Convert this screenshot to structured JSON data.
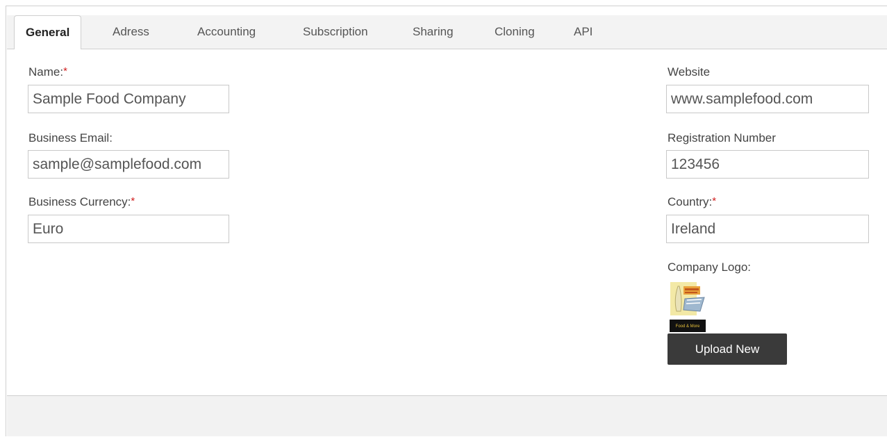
{
  "tabs": [
    {
      "label": "General",
      "active": true
    },
    {
      "label": "Adress"
    },
    {
      "label": "Accounting"
    },
    {
      "label": "Subscription"
    },
    {
      "label": "Sharing"
    },
    {
      "label": "Cloning"
    },
    {
      "label": "API"
    }
  ],
  "left": {
    "name": {
      "label": "Name:",
      "value": "Sample Food Company",
      "required_mark": "*"
    },
    "email": {
      "label": "Business Email:",
      "value": "sample@samplefood.com"
    },
    "currency": {
      "label": "Business Currency:",
      "value": "Euro",
      "required_mark": "*"
    }
  },
  "right": {
    "website": {
      "label": "Website",
      "value": "www.samplefood.com"
    },
    "registration": {
      "label": "Registration Number",
      "value": "123456"
    },
    "country": {
      "label": "Country:",
      "value": "Ireland",
      "required_mark": "*"
    },
    "logo": {
      "label": "Company Logo:",
      "caption": "Food & More"
    },
    "upload_label": "Upload New"
  },
  "colors": {
    "required": "#d12020",
    "button_bg": "#3a3a3a",
    "tabbar_bg": "#f3f3f3",
    "footer_bg": "#f2f2f2"
  }
}
